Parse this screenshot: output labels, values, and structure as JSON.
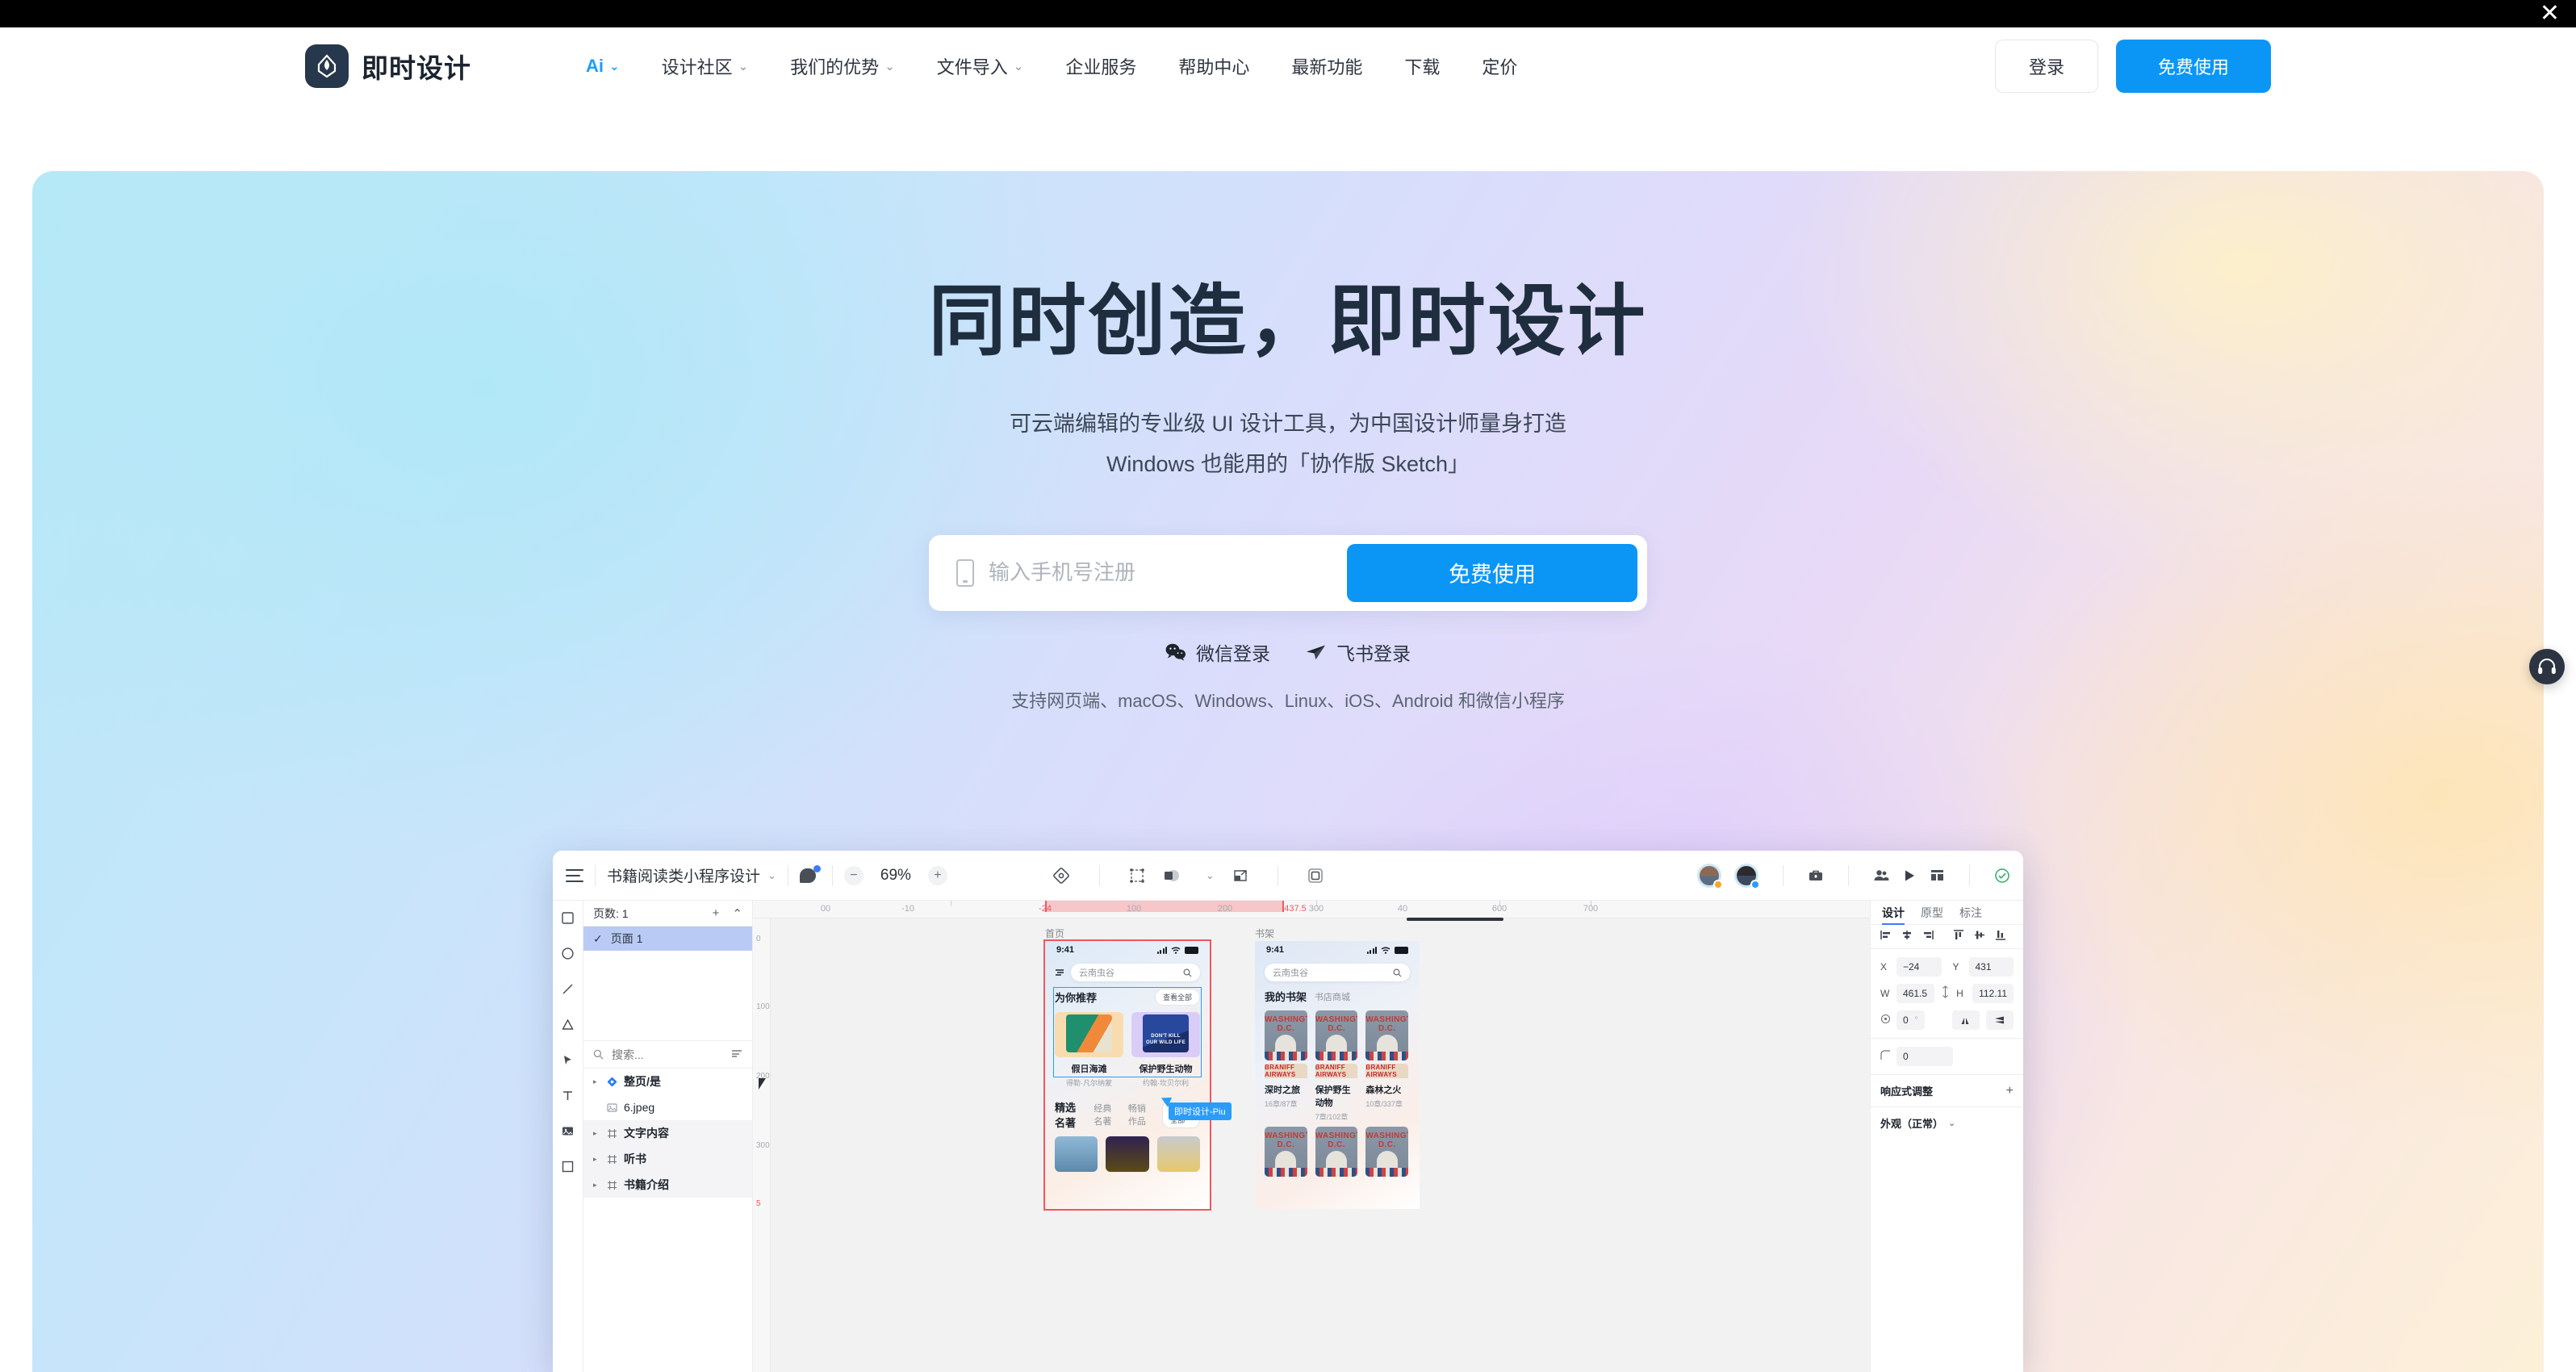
{
  "topbar": {
    "close_label": "✕"
  },
  "header": {
    "brand": "即时设计",
    "nav": [
      {
        "label": "Ai",
        "caret": "⌄",
        "accent": true
      },
      {
        "label": "设计社区",
        "caret": "⌄"
      },
      {
        "label": "我们的优势",
        "caret": "⌄"
      },
      {
        "label": "文件导入",
        "caret": "⌄"
      },
      {
        "label": "企业服务",
        "caret": ""
      },
      {
        "label": "帮助中心",
        "caret": ""
      },
      {
        "label": "最新功能",
        "caret": ""
      },
      {
        "label": "下载",
        "caret": ""
      },
      {
        "label": "定价",
        "caret": ""
      }
    ],
    "login_label": "登录",
    "free_label": "免费使用"
  },
  "hero": {
    "title": "同时创造，即时设计",
    "subtitle_line1": "可云端编辑的专业级 UI 设计工具，为中国设计师量身打造",
    "subtitle_line2": "Windows 也能用的「协作版 Sketch」",
    "signup_placeholder": "输入手机号注册",
    "signup_value": "",
    "signup_button": "免费使用",
    "social": [
      {
        "label": "微信登录",
        "icon": "wechat-icon"
      },
      {
        "label": "飞书登录",
        "icon": "feishu-icon"
      }
    ],
    "platforms": "支持网页端、macOS、Windows、Linux、iOS、Android 和微信小程序"
  },
  "app": {
    "toolbar": {
      "file_name": "书籍阅读类小程序设计",
      "caret": "⌄",
      "zoom_minus": "−",
      "zoom_value": "69%",
      "zoom_plus": "+"
    },
    "left": {
      "pages_header": "页数: 1",
      "pages_add": "+",
      "pages_collapse": "⌃",
      "page_item": "页面 1",
      "page_check": "✓",
      "search_placeholder": "搜索...",
      "layers": [
        {
          "name": "整页/是",
          "icon": "component-icon",
          "expandable": true,
          "bold": true
        },
        {
          "name": "6.jpeg",
          "icon": "image-icon",
          "expandable": false,
          "bold": false
        },
        {
          "name": "文字内容",
          "icon": "frame-icon",
          "expandable": true,
          "bold": true
        },
        {
          "name": "听书",
          "icon": "frame-icon",
          "expandable": true,
          "bold": true
        },
        {
          "name": "书籍介绍",
          "icon": "frame-icon",
          "expandable": true,
          "bold": true
        }
      ]
    },
    "canvas": {
      "ruler_ticks": [
        "00",
        "-10",
        "-24",
        "100",
        "200",
        "300",
        "40",
        "437.5",
        "600",
        "700"
      ],
      "ruler_sel_start": "-24",
      "ruler_sel_end": "437.5",
      "vruler_ticks": [
        "0",
        "100",
        "200",
        "300",
        "5"
      ],
      "artboard1": {
        "label": "首页",
        "status_time": "9:41",
        "search_value": "云南虫谷",
        "section_title": "为你推荐",
        "section_more": "查看全部",
        "books": [
          {
            "title": "假日海滩",
            "author": "得勒·凡尔纳蒙"
          },
          {
            "title": "保护野生动物",
            "author": "约翰·坎贝尔利"
          }
        ],
        "tabs": [
          "精选名著",
          "经典名著",
          "畅销作品"
        ],
        "tabs_more": "查看全部"
      },
      "artboard2": {
        "label": "书架",
        "status_time": "9:41",
        "search_value": "云南虫谷",
        "tabs": [
          "我的书架",
          "书店商城"
        ],
        "cover_text": "WASHINGTON D.C.",
        "banner_text": "BRANIFF AIRWAYS",
        "shelf": [
          {
            "title": "深时之旅",
            "progress": "16章/87章"
          },
          {
            "title": "保护野生动物",
            "progress": "7章/102章"
          },
          {
            "title": "森林之火",
            "progress": "10章/337章"
          }
        ]
      },
      "cursor_label": "即时设计-Piu"
    },
    "right": {
      "tabs": [
        {
          "label": "设计",
          "active": true
        },
        {
          "label": "原型",
          "active": false
        },
        {
          "label": "标注",
          "active": false
        }
      ],
      "x_label": "X",
      "x_value": "−24",
      "y_label": "Y",
      "y_value": "431",
      "w_label": "W",
      "w_value": "461.5",
      "h_label": "H",
      "h_value": "112.11",
      "rotation_value": "0",
      "rotation_unit": "°",
      "radius_value": "0",
      "responsive_title": "响应式调整",
      "responsive_add": "+",
      "appearance_title": "外观（正常）",
      "appearance_caret": "⌄"
    }
  },
  "colors": {
    "accent_blue": "#0b96f5",
    "brand_navy": "#27384c",
    "heading": "#1f2e3f",
    "selection_red": "#f0575e",
    "highlight_blue": "#2b9cf7",
    "page_row_blue": "#b9cbf5"
  }
}
